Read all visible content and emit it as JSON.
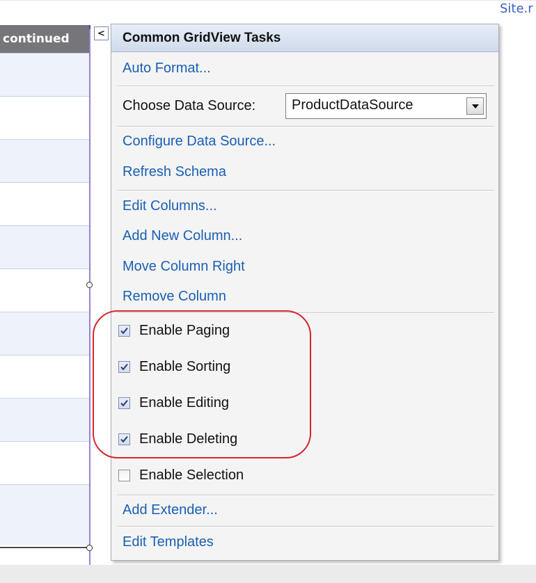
{
  "window": {
    "site_tab": "Site.r"
  },
  "grid": {
    "header_text": "continued",
    "rows": [
      {
        "shade": "light",
        "height": 62
      },
      {
        "shade": "white",
        "height": 62
      },
      {
        "shade": "light",
        "height": 62
      },
      {
        "shade": "white",
        "height": 62
      },
      {
        "shade": "light",
        "height": 62
      },
      {
        "shade": "white",
        "height": 62
      },
      {
        "shade": "light",
        "height": 62
      },
      {
        "shade": "white",
        "height": 62
      },
      {
        "shade": "light",
        "height": 62
      },
      {
        "shade": "white",
        "height": 62
      },
      {
        "shade": "light",
        "height": 88
      }
    ]
  },
  "panel": {
    "toggle_glyph": "<",
    "title": "Common GridView Tasks",
    "auto_format": "Auto Format...",
    "data_source": {
      "label": "Choose Data Source:",
      "selected": "ProductDataSource"
    },
    "configure_data_source": "Configure Data Source...",
    "refresh_schema": "Refresh Schema",
    "edit_columns": "Edit Columns...",
    "add_new_column": "Add New Column...",
    "move_column_right": "Move Column Right",
    "remove_column": "Remove Column",
    "options": [
      {
        "label": "Enable Paging",
        "checked": true
      },
      {
        "label": "Enable Sorting",
        "checked": true
      },
      {
        "label": "Enable Editing",
        "checked": true
      },
      {
        "label": "Enable Deleting",
        "checked": true
      },
      {
        "label": "Enable Selection",
        "checked": false
      }
    ],
    "add_extender": "Add Extender...",
    "edit_templates": "Edit Templates"
  },
  "colors": {
    "link": "#1a5fb4",
    "highlight": "#d6262b",
    "grid_header": "#75757a",
    "row_light": "#eef3fb"
  }
}
